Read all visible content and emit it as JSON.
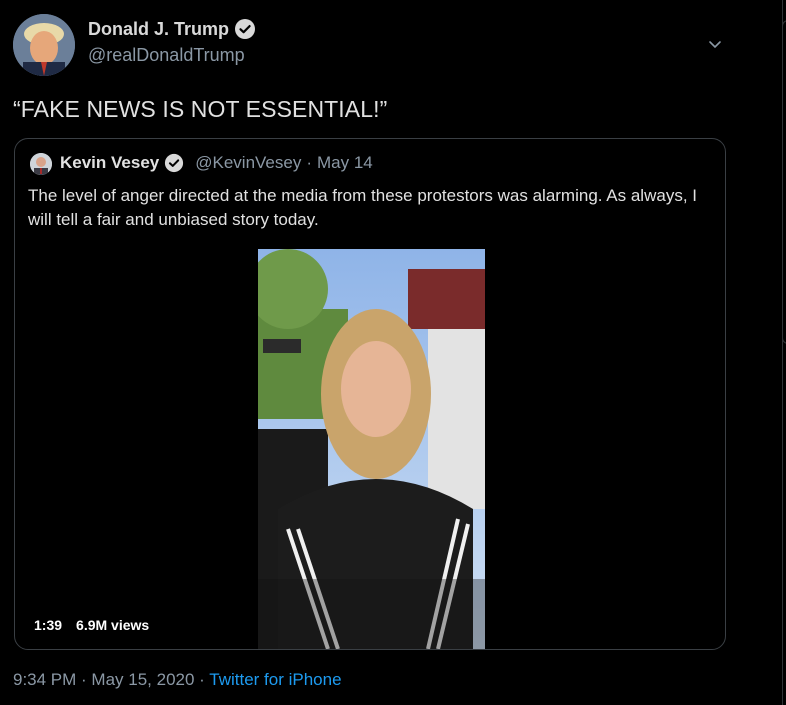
{
  "tweet": {
    "author_name": "Donald J. Trump",
    "author_handle": "@realDonaldTrump",
    "text": "“FAKE NEWS IS NOT ESSENTIAL!”",
    "timestamp": "9:34 PM · May 15, 2020",
    "separator": "·",
    "source": "Twitter for iPhone"
  },
  "quoted_tweet": {
    "author_name": "Kevin Vesey",
    "author_handle": "@KevinVesey",
    "dot": "·",
    "date": "May 14",
    "text": "The level of anger directed at the media from these protestors was alarming. As always, I will tell a fair and unbiased story today.",
    "video": {
      "duration": "1:39",
      "views": "6.9M views"
    }
  },
  "icons": {
    "verified": "verified-badge-icon",
    "more": "chevron-down-icon"
  },
  "colors": {
    "background": "#000000",
    "text": "#d9d9d9",
    "secondary": "#8b98a5",
    "link": "#1d9bf0",
    "border": "#3a3f44"
  }
}
